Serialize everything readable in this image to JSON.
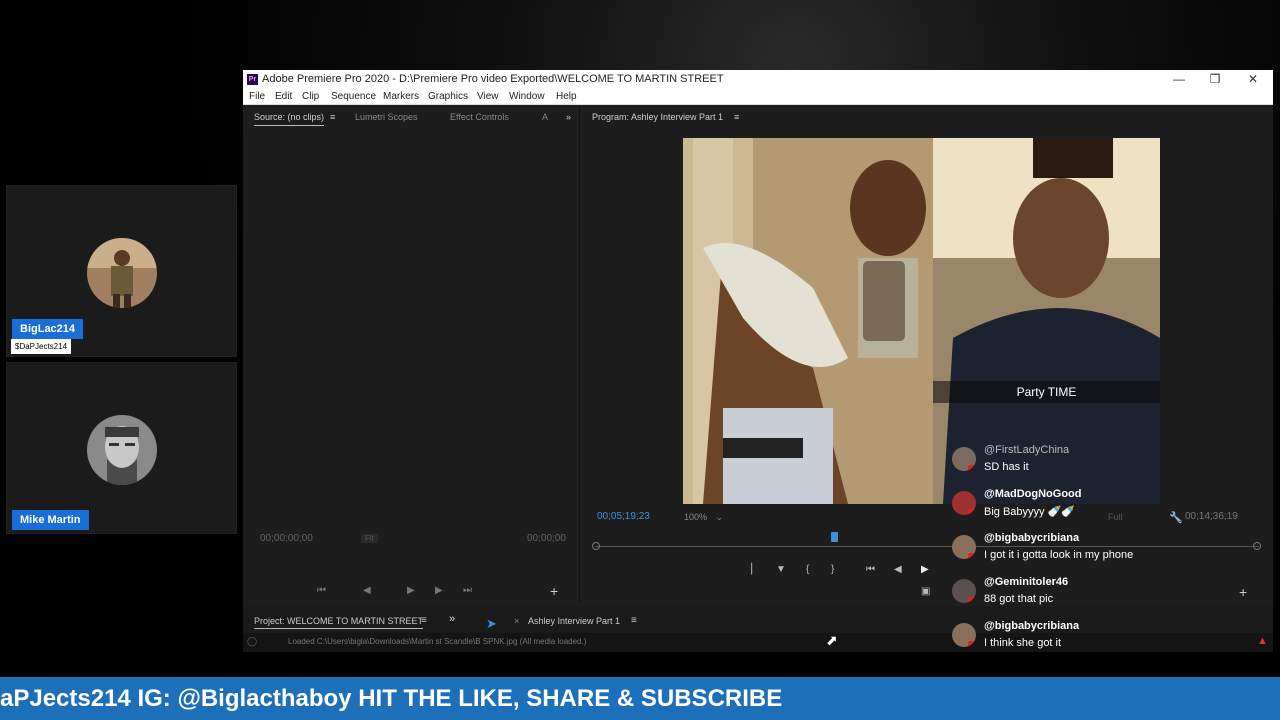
{
  "participants": [
    {
      "name": "BigLac214",
      "handle": "$DaPJects214"
    },
    {
      "name": "Mike Martin"
    }
  ],
  "app": {
    "title": "Adobe Premiere Pro 2020 - D:\\Premiere Pro video Exported\\WELCOME TO MARTIN STREET",
    "icon_text": "Pr",
    "menu": [
      "File",
      "Edit",
      "Clip",
      "Sequence",
      "Markers",
      "Graphics",
      "View",
      "Window",
      "Help"
    ]
  },
  "source_panel": {
    "tabs": [
      "Source: (no clips)",
      "Lumetri Scopes",
      "Effect Controls",
      "A"
    ],
    "timecode_left": "00;00;00;00",
    "fit_label": "Fit",
    "timecode_right": "00;00;00"
  },
  "program_panel": {
    "title": "Program: Ashley Interview Part 1",
    "timecode_current": "00;05;19;23",
    "zoom": "100%",
    "quality": "Full",
    "timecode_duration": "00;14;36;19",
    "caption": "Party TIME",
    "playhead_fraction": 0.36
  },
  "project_panel": {
    "title": "Project: WELCOME TO MARTIN STREET",
    "timeline_tab": "Ashley Interview Part 1"
  },
  "status_bar": {
    "text": "Loaded C:\\Users\\bigla\\Downloads\\Martin st Scandle\\B SPNK.jpg (All media loaded.)"
  },
  "chat": [
    {
      "user": "@FirstLadyChina",
      "text": "SD has it"
    },
    {
      "user": "@MadDogNoGood",
      "text": "Big Babyyyy 🍼🍼"
    },
    {
      "user": "@bigbabycribiana",
      "text": "I got it i gotta look in my phone"
    },
    {
      "user": "@Geminitoler46",
      "text": "88 got that pic"
    },
    {
      "user": "@bigbabycribiana",
      "text": "I think she got it"
    }
  ],
  "banner": {
    "text": "aPJects214 IG: @Biglacthaboy HIT THE LIKE, SHARE & SUBSCRIBE"
  },
  "colors": {
    "banner": "#1c6fb8",
    "name_tag": "#1a6ed8",
    "accent_timecode": "#3d8fe0"
  }
}
